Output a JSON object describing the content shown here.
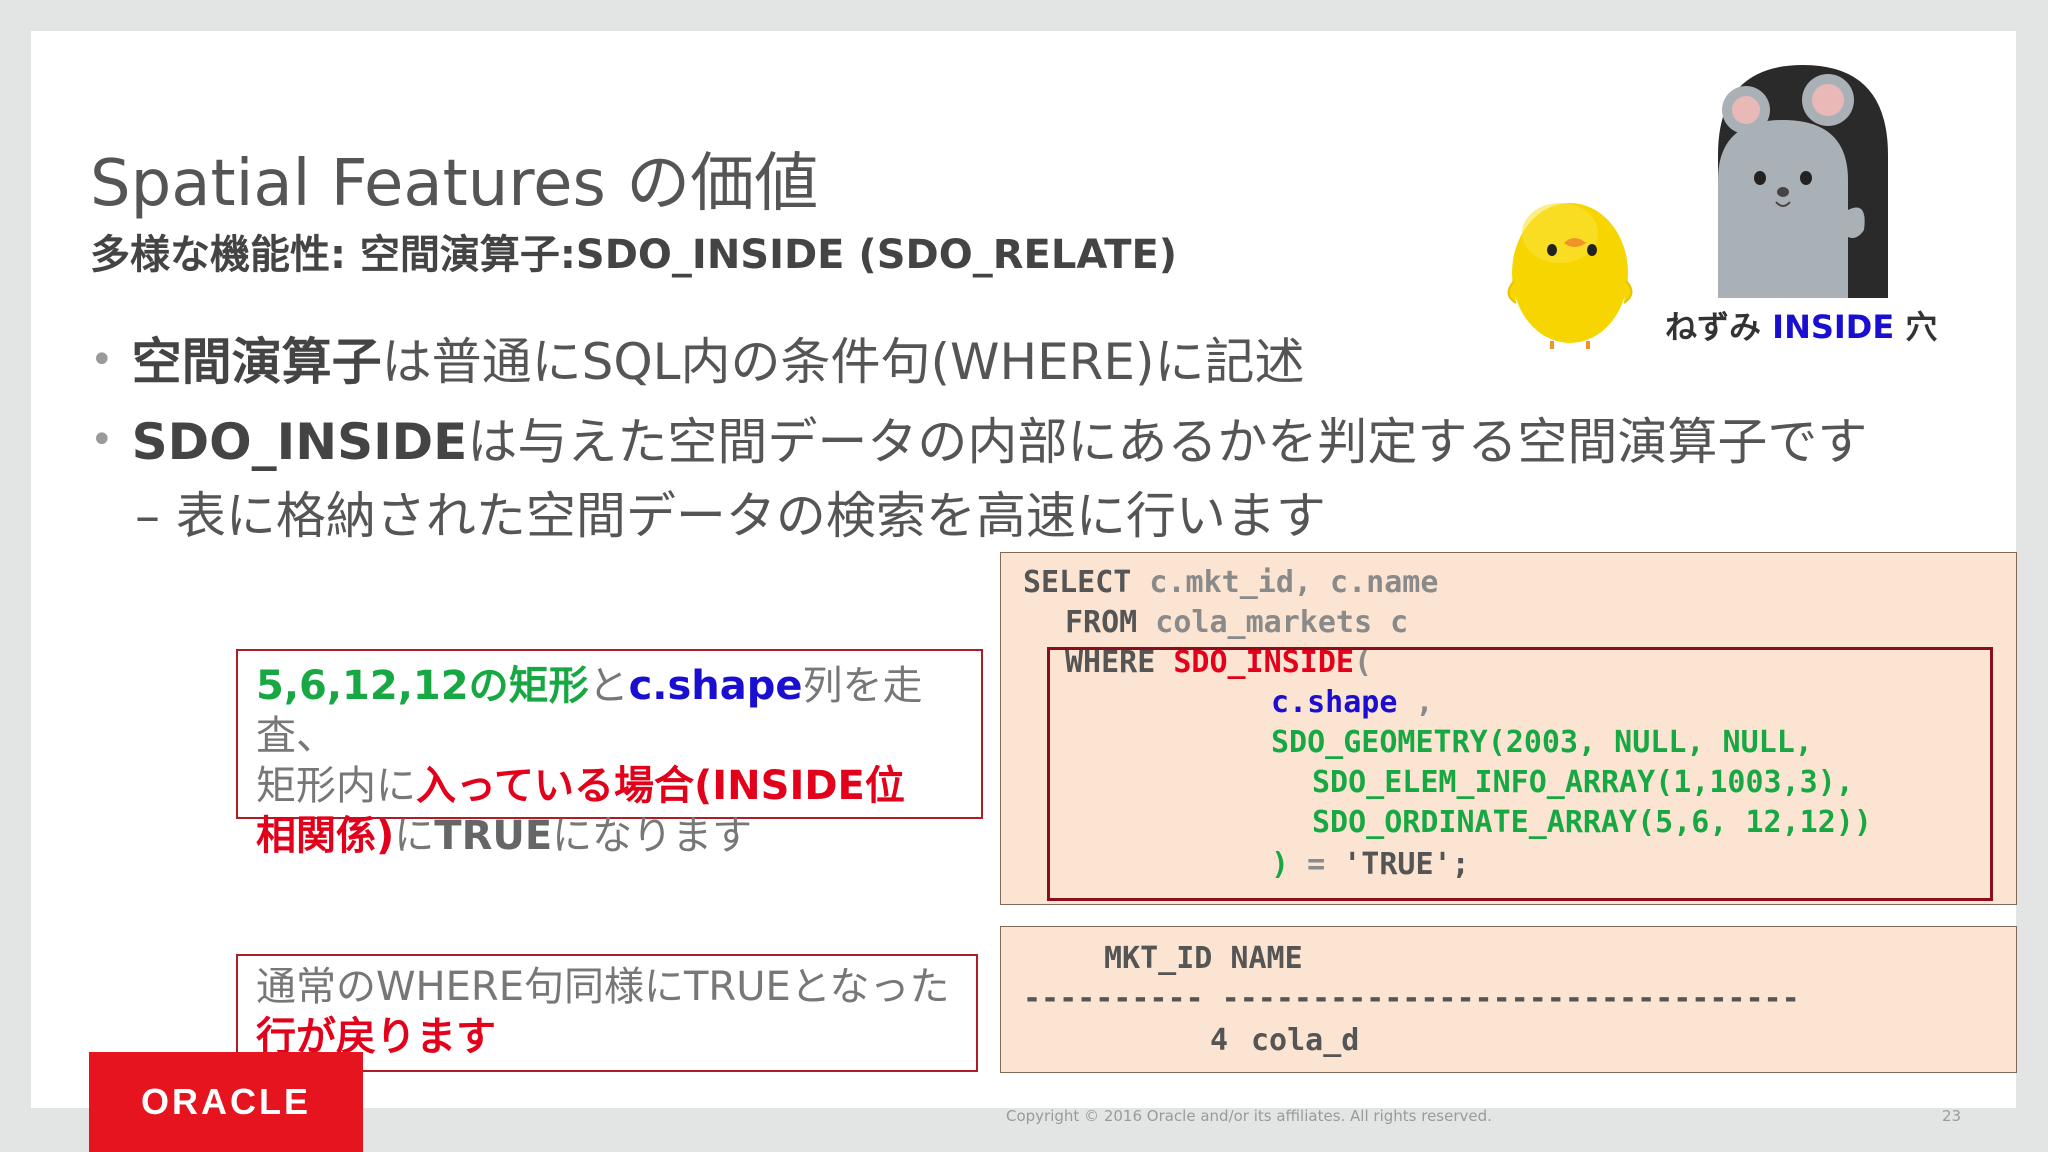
{
  "slide": {
    "title": "Spatial Features の価値",
    "subtitle": "多様な機能性: 空間演算子:SDO_INSIDE (SDO_RELATE)",
    "bullet1": {
      "bold": "空間演算子",
      "rest": "は普通にSQL内の条件句(WHERE)に記述"
    },
    "bullet2": {
      "bold": "SDO_INSIDE",
      "rest": "は与えた空間データの内部にあるかを判定する空間演算子です"
    },
    "subbullet": "– 表に格納された空間データの検索を高速に行います",
    "caption": {
      "pre": "ねずみ",
      "inside": "INSIDE",
      "post": "穴"
    },
    "code": {
      "l1_kw": "SELECT",
      "l1_arg": " c.mkt_id, c.name",
      "l2_kw": "FROM",
      "l2_arg": " cola_markets c",
      "l3_kw": "WHERE",
      "l3_fn": "SDO_INSIDE",
      "l3_paren": "(",
      "l4": "c.shape",
      "l4_comma": " ,",
      "l5": "SDO_GEOMETRY(2003, NULL, NULL,",
      "l6": "SDO_ELEM_INFO_ARRAY(1,1003,3),",
      "l7": "SDO_ORDINATE_ARRAY(5,6, 12,12))",
      "l8_close": ")",
      "l8_eq": " = ",
      "l8_val": "'TRUE';"
    },
    "result": {
      "header": "MKT_ID NAME",
      "dashes": "---------- --------------------------------",
      "row_id": "4",
      "row_name": "cola_d"
    },
    "callout1": {
      "a": "5,6,12,12の矩形",
      "b": "と",
      "c": "c.shape",
      "d": "列を走査、",
      "e": "矩形内に",
      "f": "入っている場合(INSIDE位",
      "g": "相関係)",
      "h": "に",
      "i": "TRUE",
      "j": "になります"
    },
    "callout2": {
      "a": "通常のWHERE句同様にTRUEとなった",
      "b": "行が戻ります"
    },
    "logo": "ORACLE",
    "copyright": "Copyright © 2016 Oracle and/or its affiliates. All rights reserved.",
    "page_number": "23"
  },
  "colors": {
    "oracle_red": "#e5141f",
    "code_bg": "#fbe5d2",
    "frame_red": "#8c0d1b",
    "text_red": "#e2001a",
    "text_blue": "#1a0fd1",
    "text_green": "#18a843"
  }
}
